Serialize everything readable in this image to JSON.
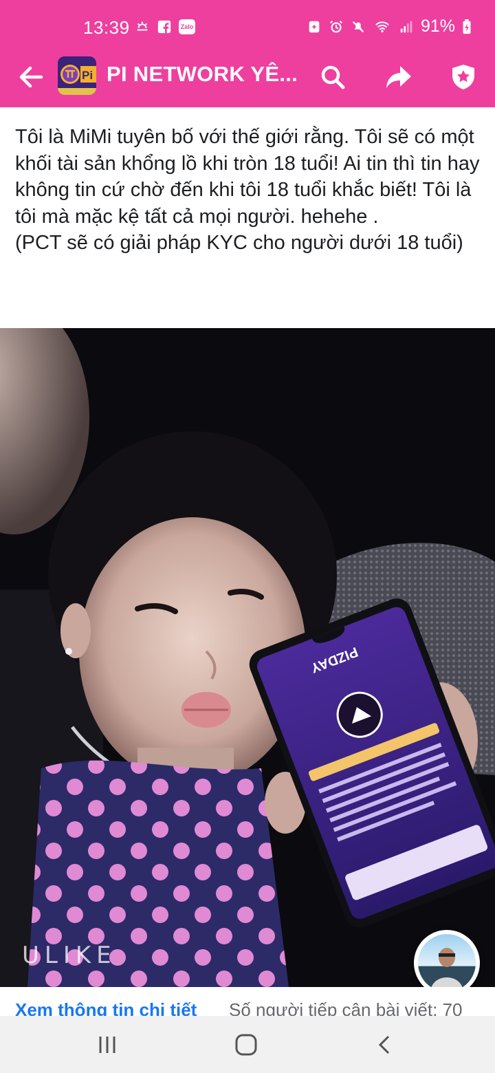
{
  "status_bar": {
    "time": "13:39",
    "battery": "91%",
    "left_icons": [
      "weather-icon",
      "facebook-icon",
      "zalo-icon"
    ],
    "right_icons": [
      "sim-icon",
      "alarm-icon",
      "mute-icon",
      "wifi-icon",
      "signal-icon",
      "battery-charging-icon"
    ],
    "zalo_label": "Zalo"
  },
  "header": {
    "title": "PI NETWORK YÊ...",
    "avatar_text": "Pi",
    "colors": {
      "background": "#ee3f9f",
      "foreground": "#ffffff"
    },
    "icons": [
      "back-arrow-icon",
      "search-icon",
      "share-icon",
      "shield-star-icon"
    ]
  },
  "post": {
    "text": "Tôi là MiMi tuyên bố với thế giới rằng. Tôi sẽ có một khối tài sản khổng lồ khi tròn 18 tuổi! Ai tin thì tin hay không tin cứ chờ đến khi tôi 18 tuổi khắc biết! Tôi là tôi mà mặc kệ tất cả mọi người. hehehe .\n(PCT sẽ có giải pháp KYC cho người dưới 18 tuổi)",
    "photo": {
      "watermark": "ULIKE",
      "phone_screen_title": "PIZDAY"
    }
  },
  "footer": {
    "view_detail": "Xem thông tin chi tiết",
    "reach": "Số người tiếp cận bài viết: 70"
  },
  "nav": {
    "icons": [
      "recent-apps-icon",
      "home-icon",
      "back-icon"
    ]
  }
}
